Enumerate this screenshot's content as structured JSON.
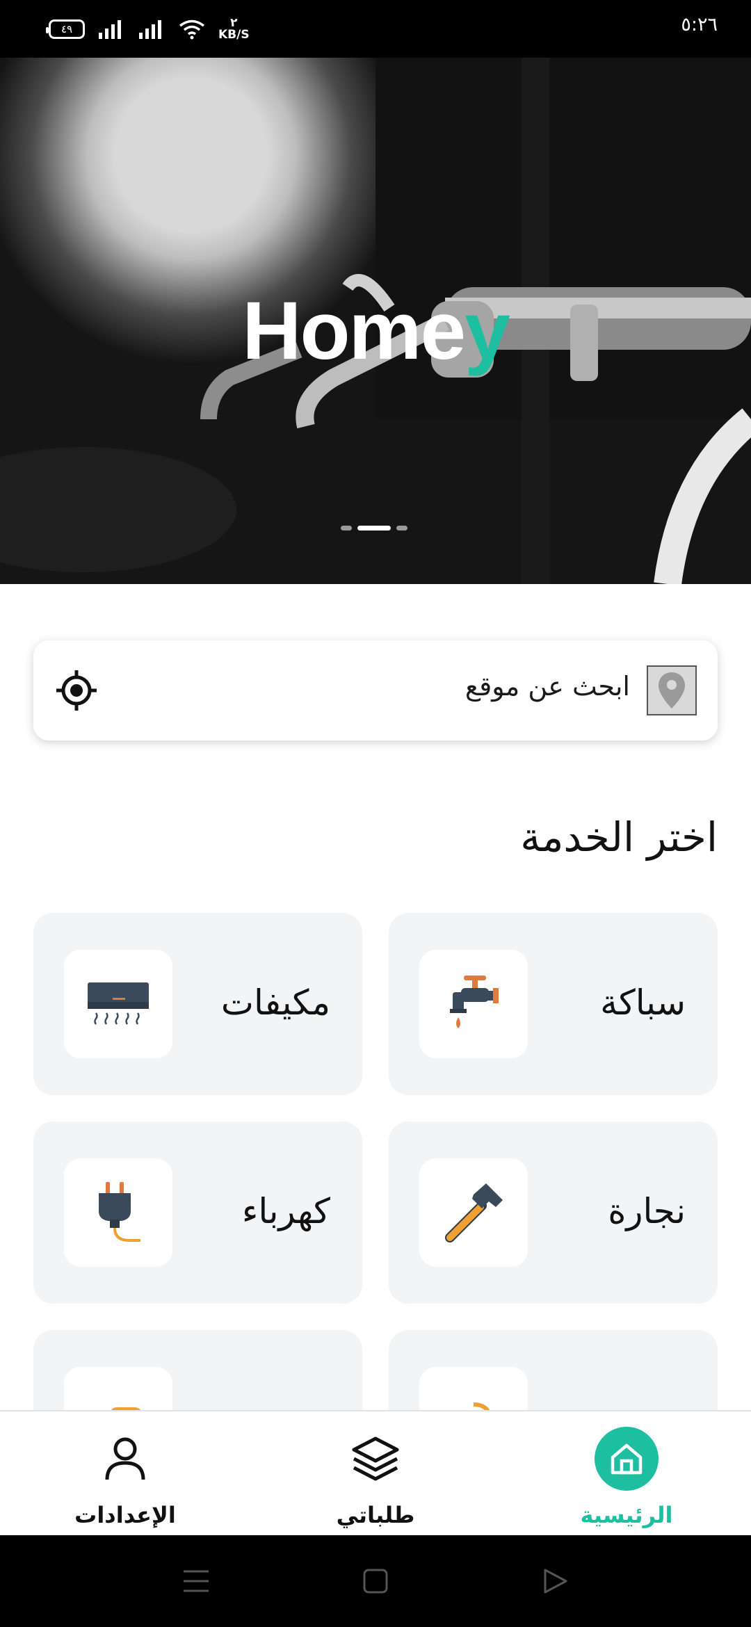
{
  "status_bar": {
    "battery": "٤٩",
    "speed_value": "٢",
    "speed_unit": "KB/S",
    "time": "٥:٢٦"
  },
  "hero": {
    "title_main": "Home",
    "title_accent": "y",
    "slide_count": 3,
    "active_slide": 2
  },
  "search": {
    "placeholder": "ابحث عن موقع"
  },
  "services": {
    "title": "اختر الخدمة",
    "items": [
      {
        "label": "سباكة",
        "icon": "faucet-icon"
      },
      {
        "label": "مكيفات",
        "icon": "air-conditioner-icon"
      },
      {
        "label": "نجارة",
        "icon": "hammer-icon"
      },
      {
        "label": "كهرباء",
        "icon": "plug-icon"
      },
      {
        "label": "",
        "icon": "satellite-icon"
      },
      {
        "label": "",
        "icon": "drill-icon"
      }
    ]
  },
  "bottom_nav": {
    "home": "الرئيسية",
    "orders": "طلباتي",
    "settings": "الإعدادات"
  },
  "colors": {
    "accent": "#1dbfa0",
    "card_bg": "#f3f4f6"
  }
}
